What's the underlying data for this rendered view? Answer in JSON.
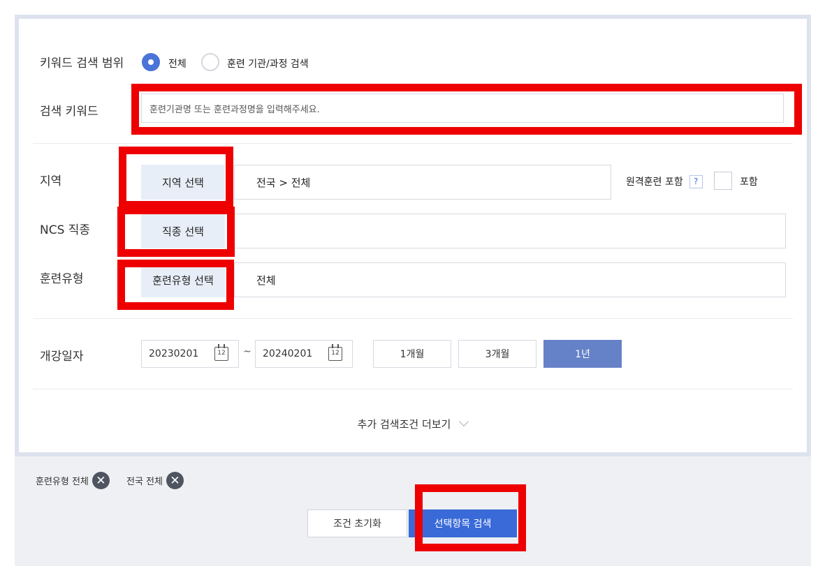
{
  "keyword_scope": {
    "label": "키워드 검색 범위",
    "options": [
      {
        "label": "전체",
        "selected": true
      },
      {
        "label": "훈련 기관/과정 검색",
        "selected": false
      }
    ]
  },
  "keyword": {
    "label": "검색 키워드",
    "placeholder": "훈련기관명 또는 훈련과정명을 입력해주세요."
  },
  "region": {
    "label": "지역",
    "button": "지역 선택",
    "value": "전국 > 전체",
    "remote_label": "원격훈련 포함",
    "help": "?",
    "include_label": "포함"
  },
  "ncs": {
    "label": "NCS 직종",
    "button": "직종 선택",
    "value": ""
  },
  "training_type": {
    "label": "훈련유형",
    "button": "훈련유형 선택",
    "value": "전체"
  },
  "start_date": {
    "label": "개강일자",
    "from": "20230201",
    "tilde": "~",
    "to": "20240201",
    "calendar_glyph": "12",
    "periods": [
      {
        "label": "1개월",
        "active": false
      },
      {
        "label": "3개월",
        "active": false
      },
      {
        "label": "1년",
        "active": true
      }
    ]
  },
  "more": {
    "label": "추가 검색조건 더보기"
  },
  "chips": [
    {
      "label": "훈련유형 전체",
      "close": "✕"
    },
    {
      "label": "전국 전체",
      "close": "✕"
    }
  ],
  "actions": {
    "reset": "조건 초기화",
    "search": "선택항목 검색"
  },
  "colors": {
    "accent": "#3a6ad8",
    "period_active": "#6582c8",
    "select_button_bg": "#e8eef8",
    "highlight": "#ee0000",
    "panel_border": "#dde2ee"
  }
}
